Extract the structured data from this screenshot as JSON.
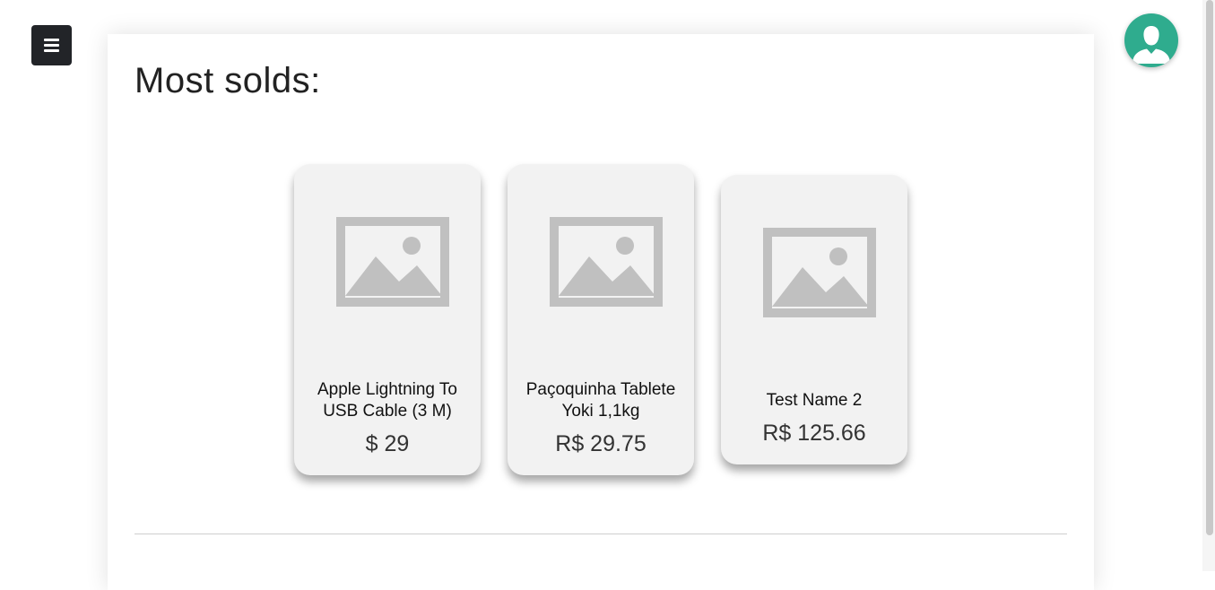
{
  "header": {
    "menu_icon": "hamburger-icon",
    "avatar_icon": "user-icon",
    "avatar_color": "#2fac8e"
  },
  "main": {
    "title": "Most solds:",
    "products": [
      {
        "name": "Apple Lightning To USB Cable (3 M)",
        "price": "$ 29",
        "image_icon": "image-placeholder-icon"
      },
      {
        "name": "Paçoquinha Tablete Yoki 1,1kg",
        "price": "R$ 29.75",
        "image_icon": "image-placeholder-icon"
      },
      {
        "name": "Test Name 2",
        "price": "R$ 125.66",
        "image_icon": "image-placeholder-icon"
      }
    ]
  }
}
